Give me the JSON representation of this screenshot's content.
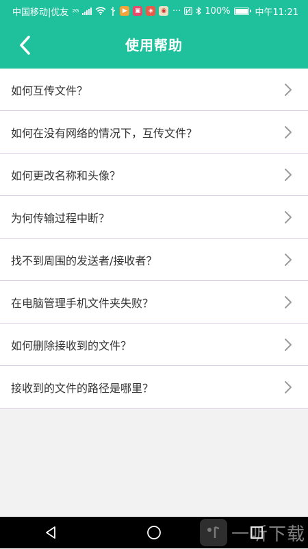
{
  "status_bar": {
    "carrier": "中国移动|优友",
    "network": "2G",
    "battery": "100%",
    "time": "中午11:21",
    "dots": "···"
  },
  "header": {
    "title": "使用帮助"
  },
  "help_items": [
    {
      "label": "如何互传文件？"
    },
    {
      "label": "如何在没有网络的情况下，互传文件？"
    },
    {
      "label": "如何更改名称和头像？"
    },
    {
      "label": "为何传输过程中断？"
    },
    {
      "label": "找不到周围的发送者/接收者？"
    },
    {
      "label": "在电脑管理手机文件夹失败？"
    },
    {
      "label": "如何删除接收到的文件？"
    },
    {
      "label": "接收到的文件的路径是哪里？"
    }
  ],
  "watermark": {
    "text": "一听下载"
  },
  "colors": {
    "accent": "#1fc09c",
    "divider": "#d8cde0",
    "text": "#333333",
    "background": "#f2f2f2"
  }
}
